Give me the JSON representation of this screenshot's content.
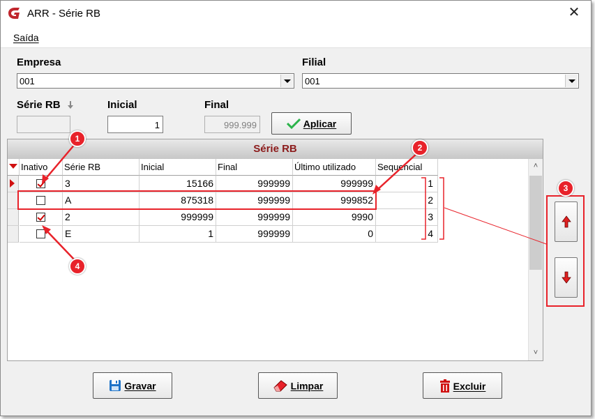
{
  "window": {
    "title": "ARR - Série RB"
  },
  "menu": {
    "items": [
      {
        "label": "Saída"
      }
    ]
  },
  "form": {
    "empresa_label": "Empresa",
    "empresa_value": "001",
    "filial_label": "Filial",
    "filial_value": "001",
    "serie_label": "Série RB",
    "serie_value": "",
    "inicial_label": "Inicial",
    "inicial_value": "1",
    "final_label": "Final",
    "final_value": "999.999",
    "aplicar_label": "Aplicar"
  },
  "grid": {
    "title": "Série RB",
    "columns": [
      "Inativo",
      "Série RB",
      "Inicial",
      "Final",
      "Último utilizado",
      "Sequencial"
    ],
    "rows": [
      {
        "inativo": true,
        "serie": "3",
        "inicial": "15166",
        "final": "999999",
        "ultimo": "999999",
        "seq": "1",
        "current": true
      },
      {
        "inativo": false,
        "serie": "A",
        "inicial": "875318",
        "final": "999999",
        "ultimo": "999852",
        "seq": "2",
        "current": false
      },
      {
        "inativo": true,
        "serie": "2",
        "inicial": "999999",
        "final": "999999",
        "ultimo": "9990",
        "seq": "3",
        "current": false
      },
      {
        "inativo": false,
        "serie": "E",
        "inicial": "1",
        "final": "999999",
        "ultimo": "0",
        "seq": "4",
        "current": false
      }
    ]
  },
  "buttons": {
    "gravar": "Gravar",
    "limpar": "Limpar",
    "excluir": "Excluir"
  },
  "annotations": {
    "badges": [
      "1",
      "2",
      "3",
      "4"
    ],
    "color": "#e8222a"
  },
  "icons": {
    "logo": "app-logo-icon",
    "close": "close-icon",
    "check": "checkmark-icon",
    "save": "floppy-disk-icon",
    "clear": "eraser-icon",
    "delete": "trash-icon",
    "up": "arrow-up-icon",
    "down": "arrow-down-icon"
  }
}
